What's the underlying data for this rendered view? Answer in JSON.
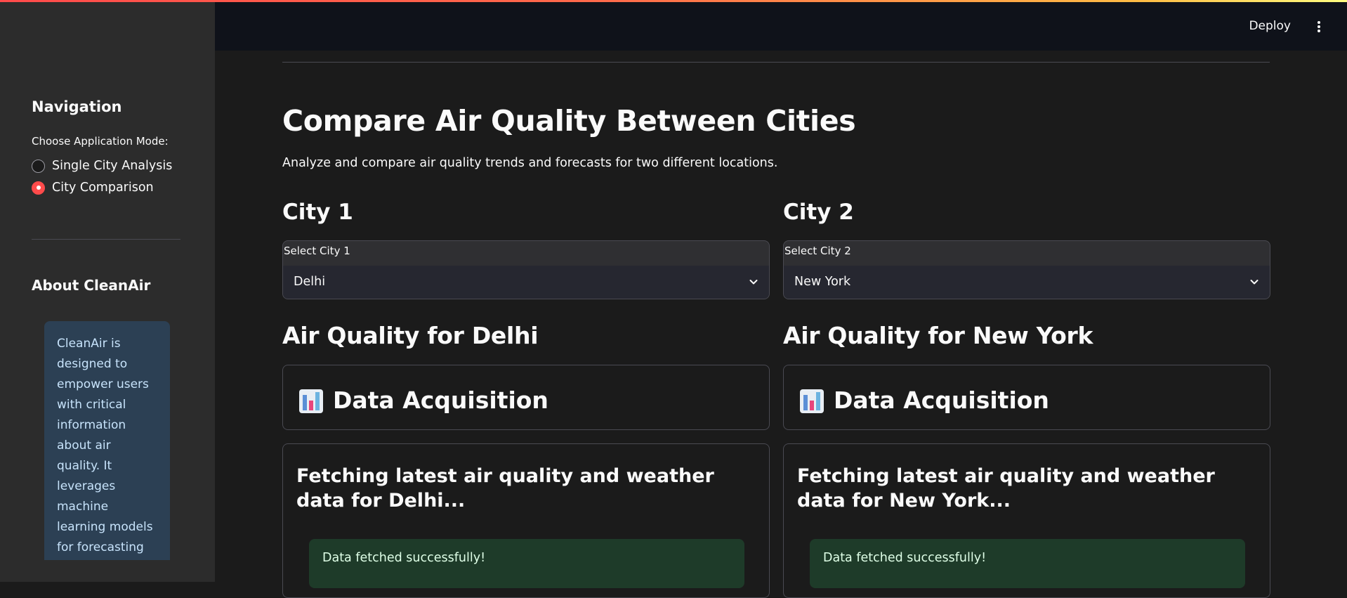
{
  "header": {
    "deploy_label": "Deploy",
    "menu_icon": "kebab-menu-icon"
  },
  "sidebar": {
    "nav_title": "Navigation",
    "mode_label": "Choose Application Mode:",
    "options": [
      {
        "label": "Single City Analysis",
        "selected": false
      },
      {
        "label": "City Comparison",
        "selected": true
      }
    ],
    "about_title": "About CleanAir",
    "about_text": "CleanAir is designed to empower users with critical information about air quality. It leverages machine learning models for forecasting and provides"
  },
  "main": {
    "title": "Compare Air Quality Between Cities",
    "subtitle": "Analyze and compare air quality trends and forecasts for two different locations.",
    "cities": [
      {
        "heading": "City 1",
        "select_label": "Select City 1",
        "select_value": "Delhi",
        "aq_heading": "Air Quality for Delhi",
        "acq_title": "Data Acquisition",
        "fetch_text": "Fetching latest air quality and weather data for Delhi...",
        "success_text": "Data fetched successfully!"
      },
      {
        "heading": "City 2",
        "select_label": "Select City 2",
        "select_value": "New York",
        "aq_heading": "Air Quality for New York",
        "acq_title": "Data Acquisition",
        "fetch_text": "Fetching latest air quality and weather data for New York...",
        "success_text": "Data fetched successfully!"
      }
    ]
  },
  "colors": {
    "accent": "#ff4b4b",
    "info_bg": "#2c4054",
    "success_bg": "#1e3b29"
  }
}
